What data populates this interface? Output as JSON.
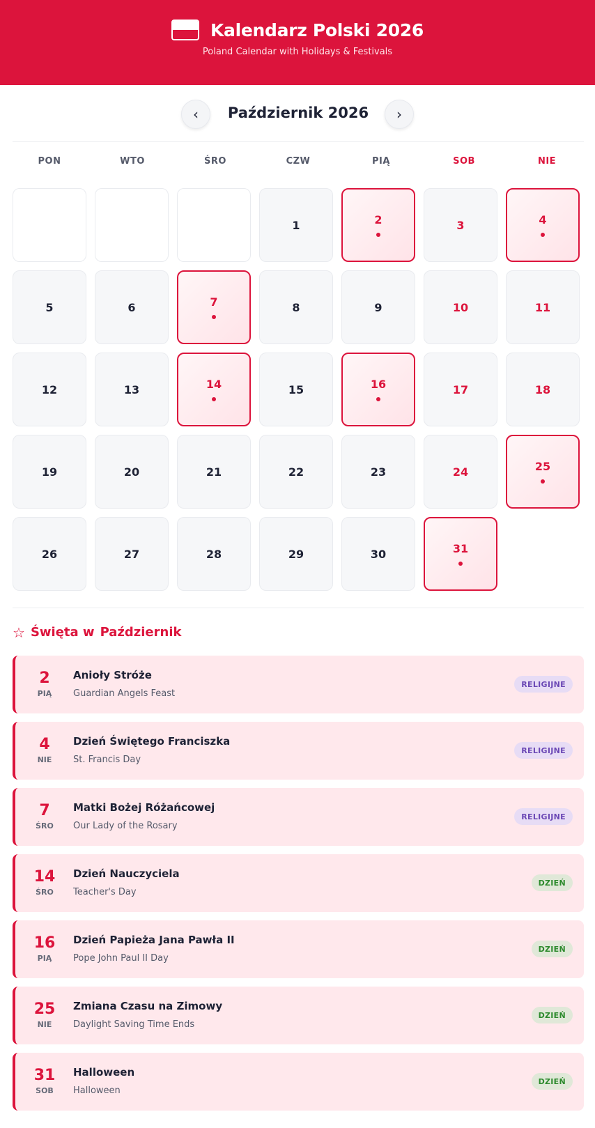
{
  "header": {
    "title": "Kalendarz Polski 2026",
    "subtitle": "Poland Calendar with Holidays & Festivals",
    "flag_icon": "poland-flag-icon"
  },
  "nav": {
    "month": "Październik 2026",
    "prev_icon": "chevron-left-icon",
    "next_icon": "chevron-right-icon",
    "prev_glyph": "‹",
    "next_glyph": "›"
  },
  "weekdays": [
    "PON",
    "WTO",
    "ŚRO",
    "CZW",
    "PIĄ",
    "SOB",
    "NIE"
  ],
  "calendar": {
    "leading_empty": 3,
    "days": [
      {
        "d": "1",
        "we": false,
        "hol": false
      },
      {
        "d": "2",
        "we": false,
        "hol": true
      },
      {
        "d": "3",
        "we": true,
        "hol": false
      },
      {
        "d": "4",
        "we": true,
        "hol": true
      },
      {
        "d": "5",
        "we": false,
        "hol": false
      },
      {
        "d": "6",
        "we": false,
        "hol": false
      },
      {
        "d": "7",
        "we": false,
        "hol": true
      },
      {
        "d": "8",
        "we": false,
        "hol": false
      },
      {
        "d": "9",
        "we": false,
        "hol": false
      },
      {
        "d": "10",
        "we": true,
        "hol": false
      },
      {
        "d": "11",
        "we": true,
        "hol": false
      },
      {
        "d": "12",
        "we": false,
        "hol": false
      },
      {
        "d": "13",
        "we": false,
        "hol": false
      },
      {
        "d": "14",
        "we": false,
        "hol": true
      },
      {
        "d": "15",
        "we": false,
        "hol": false
      },
      {
        "d": "16",
        "we": false,
        "hol": true
      },
      {
        "d": "17",
        "we": true,
        "hol": false
      },
      {
        "d": "18",
        "we": true,
        "hol": false
      },
      {
        "d": "19",
        "we": false,
        "hol": false
      },
      {
        "d": "20",
        "we": false,
        "hol": false
      },
      {
        "d": "21",
        "we": false,
        "hol": false
      },
      {
        "d": "22",
        "we": false,
        "hol": false
      },
      {
        "d": "23",
        "we": false,
        "hol": false
      },
      {
        "d": "24",
        "we": true,
        "hol": false
      },
      {
        "d": "25",
        "we": true,
        "hol": true
      },
      {
        "d": "26",
        "we": false,
        "hol": false
      },
      {
        "d": "27",
        "we": false,
        "hol": false
      },
      {
        "d": "28",
        "we": false,
        "hol": false
      },
      {
        "d": "29",
        "we": false,
        "hol": false
      },
      {
        "d": "30",
        "we": false,
        "hol": false
      },
      {
        "d": "31",
        "we": true,
        "hol": true
      }
    ]
  },
  "holidays_section": {
    "title_prefix": "Święta w",
    "title_month": "Październik",
    "icon": "star-icon",
    "glyph": "☆"
  },
  "holidays": [
    {
      "day": "2",
      "weekday": "PIĄ",
      "name": "Anioły Stróże",
      "english": "Guardian Angels Feast",
      "badge": "RELIGIJNE",
      "type": "rel"
    },
    {
      "day": "4",
      "weekday": "NIE",
      "name": "Dzień Świętego Franciszka",
      "english": "St. Francis Day",
      "badge": "RELIGIJNE",
      "type": "rel"
    },
    {
      "day": "7",
      "weekday": "ŚRO",
      "name": "Matki Bożej Różańcowej",
      "english": "Our Lady of the Rosary",
      "badge": "RELIGIJNE",
      "type": "rel"
    },
    {
      "day": "14",
      "weekday": "ŚRO",
      "name": "Dzień Nauczyciela",
      "english": "Teacher's Day",
      "badge": "DZIEŃ",
      "type": "day"
    },
    {
      "day": "16",
      "weekday": "PIĄ",
      "name": "Dzień Papieża Jana Pawła II",
      "english": "Pope John Paul II Day",
      "badge": "DZIEŃ",
      "type": "day"
    },
    {
      "day": "25",
      "weekday": "NIE",
      "name": "Zmiana Czasu na Zimowy",
      "english": "Daylight Saving Time Ends",
      "badge": "DZIEŃ",
      "type": "day"
    },
    {
      "day": "31",
      "weekday": "SOB",
      "name": "Halloween",
      "english": "Halloween",
      "badge": "DZIEŃ",
      "type": "day"
    }
  ],
  "colors": {
    "accent": "#dc143c",
    "holiday_bg": "#ffe8ec",
    "religious_badge": "#6b48b5",
    "day_badge": "#2d8a2d"
  }
}
